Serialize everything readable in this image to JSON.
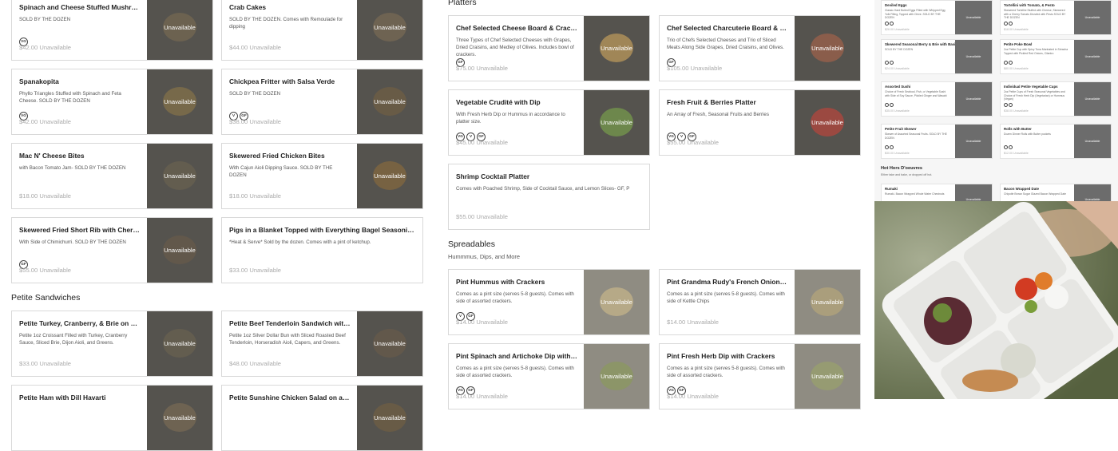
{
  "unavailable_label": "Unavailable",
  "sections": {
    "platters": "Platters",
    "petite_sandwiches": "Petite Sandwiches",
    "spreadables": "Spreadables",
    "spreadables_sub": "Hummmus, Dips, and More"
  },
  "left_col1": [
    {
      "name": "Spinach and Cheese Stuffed Mushrooms",
      "desc": "SOLD BY THE DOZEN",
      "tags": [
        "VG"
      ],
      "price": "$42.00 Unavailable"
    },
    {
      "name": "Spanakopita",
      "desc": "Phyllo Triangles Stuffed with Spinach and Feta Cheese. SOLD BY THE DOZEN",
      "tags": [
        "VG"
      ],
      "price": "$42.00 Unavailable"
    },
    {
      "name": "Mac N' Cheese Bites",
      "desc": "with Bacon Tomato Jam- SOLD BY THE DOZEN",
      "tags": [],
      "price": "$18.00 Unavailable"
    },
    {
      "name": "Skewered Fried Short Rib with Cherry Tomato",
      "desc": "With Side of Chimichurri. SOLD BY THE DOZEN",
      "tags": [
        "GF"
      ],
      "price": "$55.00 Unavailable"
    }
  ],
  "left_col2": [
    {
      "name": "Crab Cakes",
      "desc": "SOLD BY THE DOZEN. Comes with Remoulade for dipping",
      "tags": [],
      "price": "$44.00 Unavailable"
    },
    {
      "name": "Chickpea Fritter with Salsa Verde",
      "desc": "SOLD BY THE DOZEN",
      "tags": [
        "V",
        "GF"
      ],
      "price": "$38.00 Unavailable"
    },
    {
      "name": "Skewered Fried Chicken Bites",
      "desc": "With Cajun Aioli Dipping Sauce. SOLD BY THE DOZEN",
      "tags": [],
      "price": "$18.00 Unavailable"
    },
    {
      "name": "Pigs in a Blanket Topped with Everything Bagel Seasoning Side of Ketchup",
      "desc": "*Heat & Serve* Sold by the dozen. Comes with a pint of ketchup.",
      "tags": [],
      "price": "$33.00 Unavailable"
    }
  ],
  "sandwiches": [
    {
      "name": "Petite Turkey, Cranberry, & Brie on a Croissant",
      "desc": "Petite 1oz Croissant Filled with Turkey, Cranberry Sauce, Sliced Brie, Dijon Aioli, and Greens.",
      "tags": [],
      "price": "$33.00 Unavailable"
    },
    {
      "name": "Petite Beef Tenderloin Sandwich with Horseradish Aioli",
      "desc": "Petite 1oz Silver Dollar Bun with Sliced Roasted Beef Tenderloin, Horseradish Aioli, Capers, and Greens.",
      "tags": [],
      "price": "$48.00 Unavailable"
    },
    {
      "name": "Petite Ham with Dill Havarti"
    },
    {
      "name": "Petite Sunshine Chicken Salad on a Croissant"
    }
  ],
  "platters": [
    {
      "name": "Chef Selected Cheese Board & Crackers",
      "desc": "Three Types of Chef Selected Cheeses with Grapes, Dried Craisins, and Medley of Olives. Includes bowl of crackers.",
      "tags": [
        "GF"
      ],
      "price": "$75.00 Unavailable"
    },
    {
      "name": "Chef Selected Charcuterie Board & Crackers",
      "desc": "Trio of Chefs Selected Cheeses and Trio of Sliced Meats Along Side Grapes, Dried Craisins, and Olives.",
      "tags": [
        "GF"
      ],
      "price": "$105.00 Unavailable"
    },
    {
      "name": "Vegetable Crudité with Dip",
      "desc": "With Fresh Herb Dip or Hummus in accordance to platter size.",
      "tags": [
        "VG",
        "V",
        "GF"
      ],
      "price": "$45.00 Unavailable"
    },
    {
      "name": "Fresh Fruit & Berries Platter",
      "desc": "An Array of Fresh, Seasonal Fruits and Berries",
      "tags": [
        "VG",
        "V",
        "GF"
      ],
      "price": "$55.00 Unavailable"
    },
    {
      "name": "Shrimp Cocktail Platter",
      "desc": "Comes with Poached Shrimp, Side of Cocktail Sauce, and Lemon Slices- GF, P",
      "tags": [],
      "price": "$55.00 Unavailable"
    }
  ],
  "spreadables": [
    {
      "name": "Pint Hummus with Crackers",
      "desc": "Comes as a pint size (serves 5-8 guests). Comes with side of assorted crackers.",
      "tags": [
        "V",
        "GF"
      ],
      "price": "$14.00 Unavailable"
    },
    {
      "name": "Pint Grandma Rudy's French Onion Dip with Kettle Chips",
      "desc": "Comes as a pint size (serves 5-8 guests). Comes with side of Kettle Chips",
      "tags": [],
      "price": "$14.00 Unavailable"
    },
    {
      "name": "Pint Spinach and Artichoke Dip with Crackers",
      "desc": "Comes as a pint size (serves 5-8 guests). Comes with side of assorted crackers.",
      "tags": [
        "VG",
        "GF"
      ],
      "price": "$14.00 Unavailable"
    },
    {
      "name": "Pint Fresh Herb Dip with Crackers",
      "desc": "Comes as a pint size (serves 5-8 guests). Comes with side of assorted crackers.",
      "tags": [
        "VG",
        "GF"
      ],
      "price": "$14.00 Unavailable"
    }
  ],
  "preview": {
    "section_title": "Hot Hors D'oeuvres",
    "section_sub": "Either take and bake, or dropped off hot.",
    "items": [
      {
        "name": "Deviled Eggs",
        "desc": "Classic Hard Boiled Eggs Filled with Whipped Egg Yolk Filling, Topped with Chive. SOLD BY THE DOZEN",
        "price": "$26.00 Unavailable"
      },
      {
        "name": "Tortellini with Tomato, & Pesto",
        "desc": "Skewered Tortellini Stuffed with Cheese, Skewered with a Cherry Tomato Drizzled with Pesto SOLD BY THE DOZEN",
        "price": "$18.00 Unavailable"
      },
      {
        "name": "Skewered Seasonal Berry & Brie with Basil",
        "desc": "SOLD BY THE DOZEN",
        "price": "$24.00 Unavailable"
      },
      {
        "name": "Petite Poke Bowl",
        "desc": "2oz Petite Cup with Spicy Tuna Marinated in Sriracha Topped with Pickled Red Onions, Cilantro",
        "price": "$80.00 Unavailable"
      },
      {
        "name": "Assorted Sushi",
        "desc": "Choice of Fresh Seafood, Fish, or Vegetable Sushi with Side of Soy Sauce, Pickled Ginger and Wasabi",
        "price": "$35.00 Unavailable"
      },
      {
        "name": "Individual Petite Vegetable Cups",
        "desc": "2oz Petite Cups of Fresh Seasonal Vegetables and Choice of Fresh Herb Dip (Vegetarian) or Hummus (Vegan)",
        "price": "$38.00 Unavailable"
      },
      {
        "name": "Petite Fruit Skewer",
        "desc": "Skewer of Assorted Seasonal Fruits. SOLD BY THE DOZEN",
        "price": "$30.00 Unavailable"
      },
      {
        "name": "Rolls with Butter",
        "desc": "Dozen Dinner Rolls with Butter pockets",
        "price": "$12.00 Unavailable"
      },
      {
        "name": "Rumaki",
        "desc": "Rumaki- Bacon Wrapped Whole Water Chestnuts",
        "price": ""
      },
      {
        "name": "Bacon Wrapped Date",
        "desc": "Chipotle Brown Sugar Glazed Bacon Wrapped Date",
        "price": ""
      }
    ]
  }
}
